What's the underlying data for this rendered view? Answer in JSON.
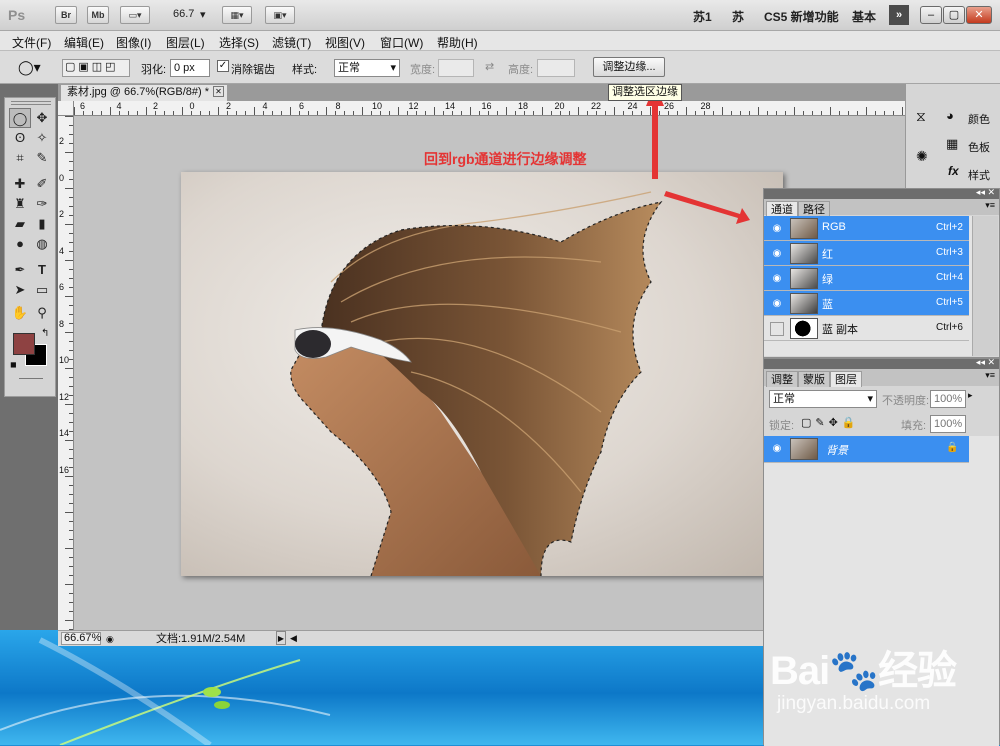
{
  "app": {
    "logo": "Ps",
    "btn_br": "Br",
    "btn_mb": "Mb",
    "zoom_select": "66.7",
    "workspace_user1": "苏1",
    "workspace_user2": "苏",
    "workspace_cs5": "CS5 新增功能",
    "workspace_basic": "基本",
    "expand": "»"
  },
  "window_controls": {
    "minimize": "–",
    "restore": "▢",
    "close": "✕"
  },
  "menu": [
    "文件(F)",
    "编辑(E)",
    "图像(I)",
    "图层(L)",
    "选择(S)",
    "滤镜(T)",
    "视图(V)",
    "窗口(W)",
    "帮助(H)"
  ],
  "options": {
    "feather_label": "羽化:",
    "feather_value": "0 px",
    "antialias_label": "消除锯齿",
    "antialias_checked": true,
    "style_label": "样式:",
    "style_value": "正常",
    "width_label": "宽度:",
    "height_label": "高度:",
    "refine_button": "调整边缘...",
    "tooltip": "调整选区边缘"
  },
  "document": {
    "tab_title": "素材.jpg @ 66.7%(RGB/8#) *",
    "ruler_top": [
      "6",
      "4",
      "2",
      "0",
      "2",
      "4",
      "6",
      "8",
      "10",
      "12",
      "14",
      "16",
      "18",
      "20",
      "22",
      "24",
      "26",
      "28"
    ],
    "ruler_left": [
      "2",
      "0",
      "2",
      "4",
      "6",
      "8",
      "10",
      "12",
      "14",
      "16"
    ]
  },
  "status": {
    "zoom": "66.67%",
    "doc_size": "文档:1.91M/2.54M"
  },
  "annotation": "回到rgb通道进行边缘调整",
  "right_dock": {
    "color": "颜色",
    "swatches": "色板",
    "styles": "样式"
  },
  "channels_panel": {
    "tabs": [
      "通道",
      "路径"
    ],
    "rows": [
      {
        "name": "RGB",
        "shortcut": "Ctrl+2",
        "selected": true,
        "visible": true
      },
      {
        "name": "红",
        "shortcut": "Ctrl+3",
        "selected": true,
        "visible": true
      },
      {
        "name": "绿",
        "shortcut": "Ctrl+4",
        "selected": true,
        "visible": true
      },
      {
        "name": "蓝",
        "shortcut": "Ctrl+5",
        "selected": true,
        "visible": true
      },
      {
        "name": "蓝 副本",
        "shortcut": "Ctrl+6",
        "selected": false,
        "visible": false
      }
    ]
  },
  "layers_panel": {
    "tabs": [
      "调整",
      "蒙版",
      "图层"
    ],
    "blend_mode": "正常",
    "opacity_label": "不透明度:",
    "opacity_value": "100%",
    "lock_label": "锁定:",
    "fill_label": "填充:",
    "fill_value": "100%",
    "layer_name": "背景"
  },
  "watermark": {
    "brand": "Bai",
    "brand_cn": "经验",
    "url": "jingyan.baidu.com"
  },
  "icons": [
    "eye-icon",
    "lock-icon",
    "marquee-icon",
    "move-icon",
    "lasso-icon",
    "wand-icon",
    "crop-icon",
    "eyedropper-icon",
    "brush-icon",
    "stamp-icon",
    "eraser-icon",
    "gradient-icon",
    "pen-icon",
    "text-icon",
    "hand-icon",
    "zoom-icon"
  ]
}
